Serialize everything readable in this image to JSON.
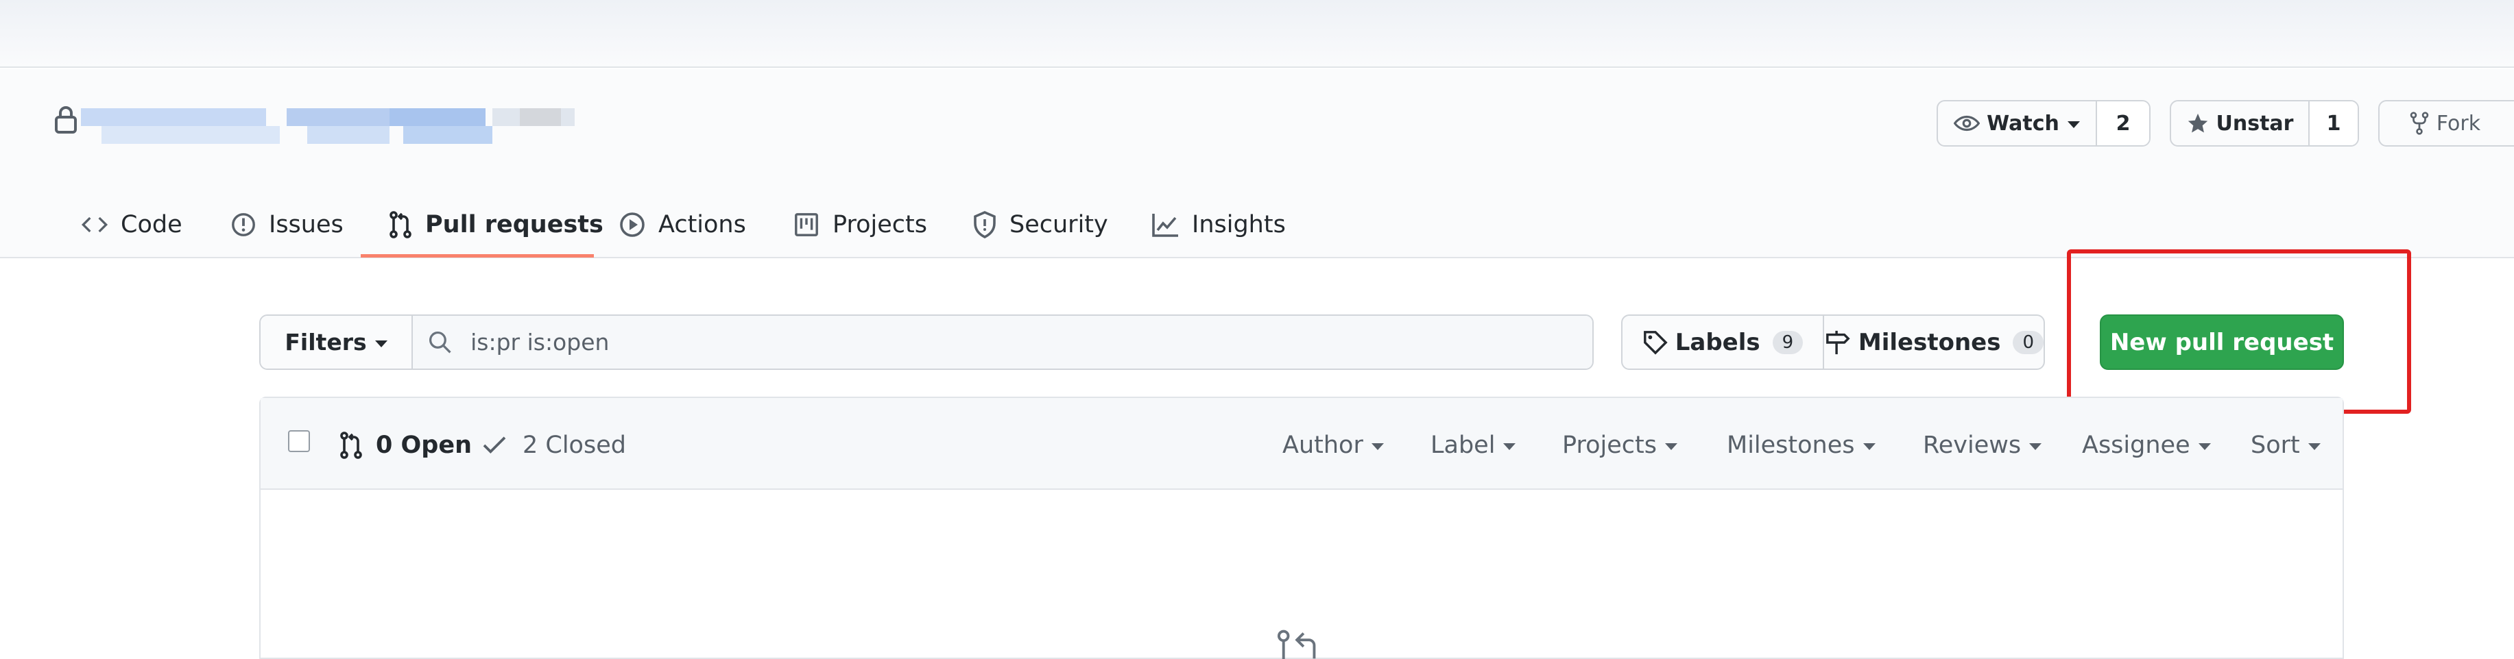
{
  "repo": {
    "lock_icon": "lock-icon"
  },
  "actions": {
    "watch": {
      "label": "Watch",
      "count": "2"
    },
    "unstar": {
      "label": "Unstar",
      "count": "1"
    },
    "fork": {
      "label": "Fork"
    }
  },
  "tabs": [
    {
      "label": "Code",
      "icon": "code-icon"
    },
    {
      "label": "Issues",
      "icon": "issue-icon"
    },
    {
      "label": "Pull requests",
      "icon": "pull-request-icon",
      "selected": true
    },
    {
      "label": "Actions",
      "icon": "play-icon"
    },
    {
      "label": "Projects",
      "icon": "project-icon"
    },
    {
      "label": "Security",
      "icon": "shield-icon"
    },
    {
      "label": "Insights",
      "icon": "graph-icon"
    }
  ],
  "filters": {
    "label": "Filters",
    "search_value": "is:pr is:open"
  },
  "labels": {
    "label": "Labels",
    "count": "9"
  },
  "milestones": {
    "label": "Milestones",
    "count": "0"
  },
  "new_pr": {
    "label": "New pull request"
  },
  "list": {
    "open_label": "0 Open",
    "closed_label": "2 Closed",
    "sorts": [
      "Author",
      "Label",
      "Projects",
      "Milestones",
      "Reviews",
      "Assignee",
      "Sort"
    ]
  },
  "colors": {
    "accent_green": "#2ea44f",
    "tab_underline": "#f9826c",
    "highlight_box": "#e22121"
  }
}
